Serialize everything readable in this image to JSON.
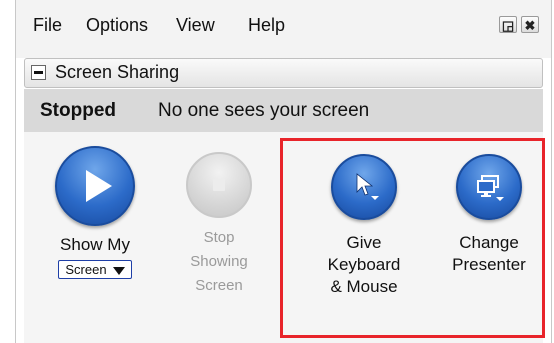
{
  "menu": {
    "items": [
      "File",
      "Options",
      "View",
      "Help"
    ],
    "restore_glyph": "◲",
    "close_glyph": "✖"
  },
  "section": {
    "title": "Screen Sharing"
  },
  "status": {
    "state": "Stopped",
    "message": "No one sees your screen"
  },
  "actions": {
    "show_my": {
      "label_line1": "Show My",
      "select_value": "Screen",
      "icon": "play-icon",
      "enabled": true
    },
    "stop": {
      "label_line1": "Stop",
      "label_line2": "Showing",
      "label_line3": "Screen",
      "icon": "stop-icon",
      "enabled": false
    },
    "give": {
      "label_line1": "Give",
      "label_line2": "Keyboard",
      "label_line3": "& Mouse",
      "icon": "cursor-icon"
    },
    "change": {
      "label_line1": "Change",
      "label_line2": "Presenter",
      "icon": "monitor-icon"
    }
  },
  "colors": {
    "accent_blue": "#2c6bc9",
    "highlight_red": "#e8242a",
    "status_bg": "#d9d9d9"
  }
}
